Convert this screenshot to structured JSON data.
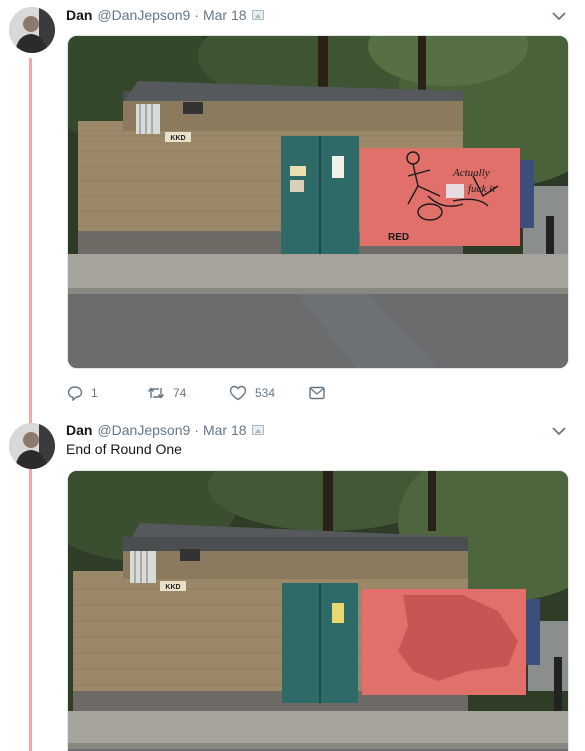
{
  "tweets": [
    {
      "name": "Dan",
      "handle": "@DanJepson9",
      "separator": "·",
      "date": "Mar 18",
      "text": "",
      "photo_graffiti": [
        "Actually",
        "fuck it",
        "RED"
      ],
      "photo_sign": "KKD",
      "replies": "1",
      "retweets": "74",
      "likes": "534",
      "icons": [
        "reply-icon",
        "retweet-icon",
        "like-icon",
        "message-icon"
      ]
    },
    {
      "name": "Dan",
      "handle": "@DanJepson9",
      "separator": "·",
      "date": "Mar 18",
      "text": "End of Round One",
      "photo_sign": "KKD"
    }
  ],
  "colors": {
    "thread_line": "#f0a7a7",
    "secondary_text": "#657786",
    "red_wall": "#e1706a"
  }
}
